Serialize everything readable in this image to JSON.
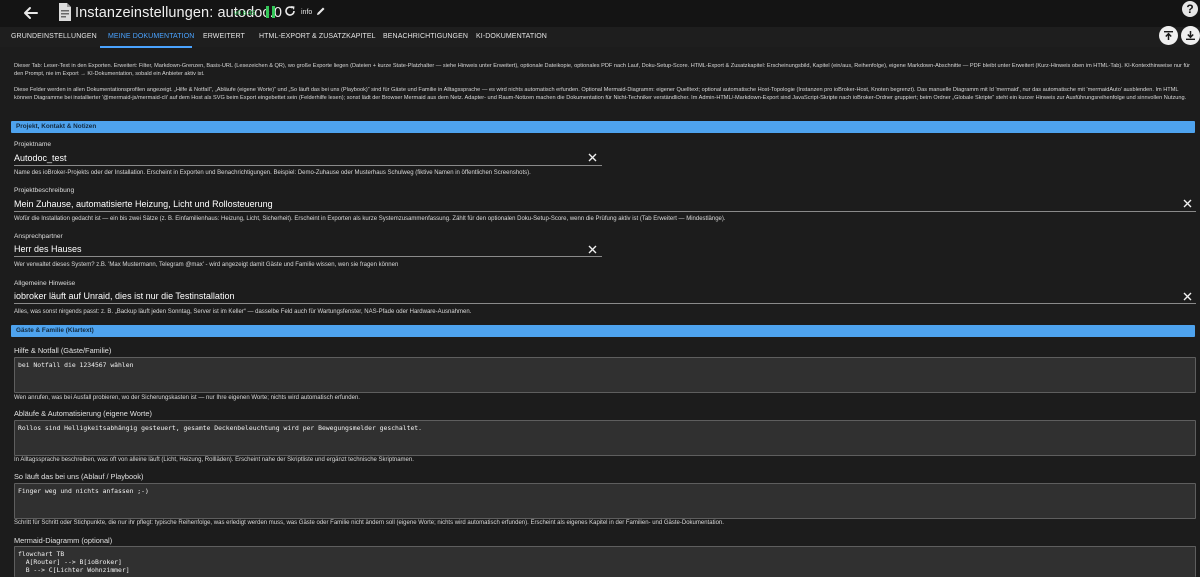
{
  "header": {
    "title": "Instanzeinstellungen: autodoc.0",
    "version": "v0.6.45",
    "info_label": "info"
  },
  "tabs": [
    {
      "label": "GRUNDEINSTELLUNGEN"
    },
    {
      "label": "MEINE DOKUMENTATION"
    },
    {
      "label": "ERWEITERT"
    },
    {
      "label": "HTML-EXPORT & ZUSATZKAPITEL"
    },
    {
      "label": "BENACHRICHTIGUNGEN"
    },
    {
      "label": "KI-DOKUMENTATION"
    }
  ],
  "active_tab": "MEINE DOKUMENTATION",
  "intro": {
    "p1": "Dieser Tab: Leser-Text in den Exporten. Erweitert: Filter, Markdown-Grenzen, Basis-URL (Lesezeichen & QR), wo große Exporte liegen (Dateien + kurze State-Platzhalter — siehe Hinweis unter Erweitert), optionale Dateikopie, optionales PDF nach Lauf, Doku-Setup-Score. HTML-Export & Zusatzkapitel: Erscheinungsbild, Kapitel (ein/aus, Reihenfolge), eigene Markdown-Abschnitte — PDF bleibt unter Erweitert (Kurz-Hinweis oben im HTML-Tab). KI-Kontexthinweise nur für den Prompt, nie im Export → KI-Dokumentation, sobald ein Anbieter aktiv ist.",
    "p2": "Diese Felder werden in allen Dokumentationsprofilen angezeigt. „Hilfe & Notfall“, „Abläufe (eigene Worte)“ und „So läuft das bei uns (Playbook)“ sind für Gäste und Familie in Alltagssprache — es wird nichts automatisch erfunden. Optional Mermaid-Diagramm: eigener Quelltext; optional automatische Host-Topologie (Instanzen pro ioBroker-Host, Knoten begrenzt). Das manuelle Diagramm mit Id 'mermaid', nur das automatische mit 'mermaidAuto' ausblenden. Im HTML können Diagramme bei installierter '@mermaid-js/mermaid-cli' auf dem Host als SVG beim Export eingebettet sein (Felderhilfe lesen); sonst lädt der Browser Mermaid aus dem Netz. Adapter- und Raum-Notizen machen die Dokumentation für Nicht-Techniker verständlicher. Im Admin-HTML/-Markdown-Export sind JavaScript-Skripte nach ioBroker-Ordner gruppiert; beim Ordner „Globale Skripte“ steht ein kurzer Hinweis zur Ausführungsreihenfolge und sinnvollen Nutzung."
  },
  "sections": {
    "project": "Projekt, Kontakt & Notizen",
    "guests": "Gäste & Familie (Klartext)"
  },
  "fields": {
    "project_name": {
      "label": "Projektname",
      "value": "Autodoc_test",
      "helper": "Name des ioBroker-Projekts oder der Installation. Erscheint in Exporten und Benachrichtigungen. Beispiel: Demo-Zuhause oder Musterhaus Schulweg (fiktive Namen in öffentlichen Screenshots)."
    },
    "project_description": {
      "label": "Projektbeschreibung",
      "value": "Mein Zuhause, automatisierte Heizung, Licht und Rollosteuerung",
      "helper": "Wofür die Installation gedacht ist — ein bis zwei Sätze (z. B. Einfamilienhaus: Heizung, Licht, Sicherheit). Erscheint in Exporten als kurze Systemzusammenfassung. Zählt für den optionalen Doku-Setup-Score, wenn die Prüfung aktiv ist (Tab Erweitert — Mindestlänge)."
    },
    "contact": {
      "label": "Ansprechpartner",
      "value": "Herr des Hauses",
      "helper": "Wer verwaltet dieses System? z.B. 'Max Mustermann, Telegram @max' - wird angezeigt damit Gäste und Familie wissen, wen sie fragen können"
    },
    "notes": {
      "label": "Allgemeine Hinweise",
      "value": "iobroker läuft auf Unraid, dies ist nur die Testinstallation",
      "helper": "Alles, was sonst nirgends passt: z. B. „Backup läuft jeden Sonntag, Server ist im Keller“ — dasselbe Feld auch für Wartungsfenster, NAS-Pfade oder Hardware-Ausnahmen."
    },
    "help_emergency": {
      "label": "Hilfe & Notfall (Gäste/Familie)",
      "value": "bei Notfall die 1234567 wählen",
      "helper": "Wen anrufen, was bei Ausfall probieren, wo der Sicherungskasten ist — nur Ihre eigenen Worte; nichts wird automatisch erfunden."
    },
    "routines": {
      "label": "Abläufe & Automatisierung (eigene Worte)",
      "value": "Rollos sind Helligkeitsabhängig gesteuert, gesamte Deckenbeleuchtung wird per Bewegungsmelder geschaltet.",
      "helper": "In Alltagssprache beschreiben, was oft von alleine läuft (Licht, Heizung, Rollläden). Erscheint nahe der Skriptliste und ergänzt technische Skriptnamen."
    },
    "playbook": {
      "label": "So läuft das bei uns (Ablauf / Playbook)",
      "value": "Finger weg und nichts anfassen ;-)",
      "helper": "Schritt für Schritt oder Stichpunkte, die nur ihr pflegt: typische Reihenfolge, was erledigt werden muss, was Gäste oder Familie nicht ändern soll (eigene Worte; nichts wird automatisch erfunden). Erscheint als eigenes Kapitel in der Familien- und Gäste-Dokumentation."
    },
    "mermaid": {
      "label": "Mermaid-Diagramm (optional)",
      "value": "flowchart TB\n  A[Router] --> B[ioBroker]\n  B --> C[Lichter Wohnzimmer]"
    }
  },
  "colors": {
    "accent": "#4aa3ff",
    "section_bar": "#4ea3ee",
    "status_green": "#34c759"
  },
  "icons": [
    "back-arrow-icon",
    "adapter-logo-icon",
    "pause-icon",
    "reload-icon",
    "pencil-icon",
    "help-icon",
    "upload-icon",
    "download-icon",
    "clear-icon"
  ]
}
